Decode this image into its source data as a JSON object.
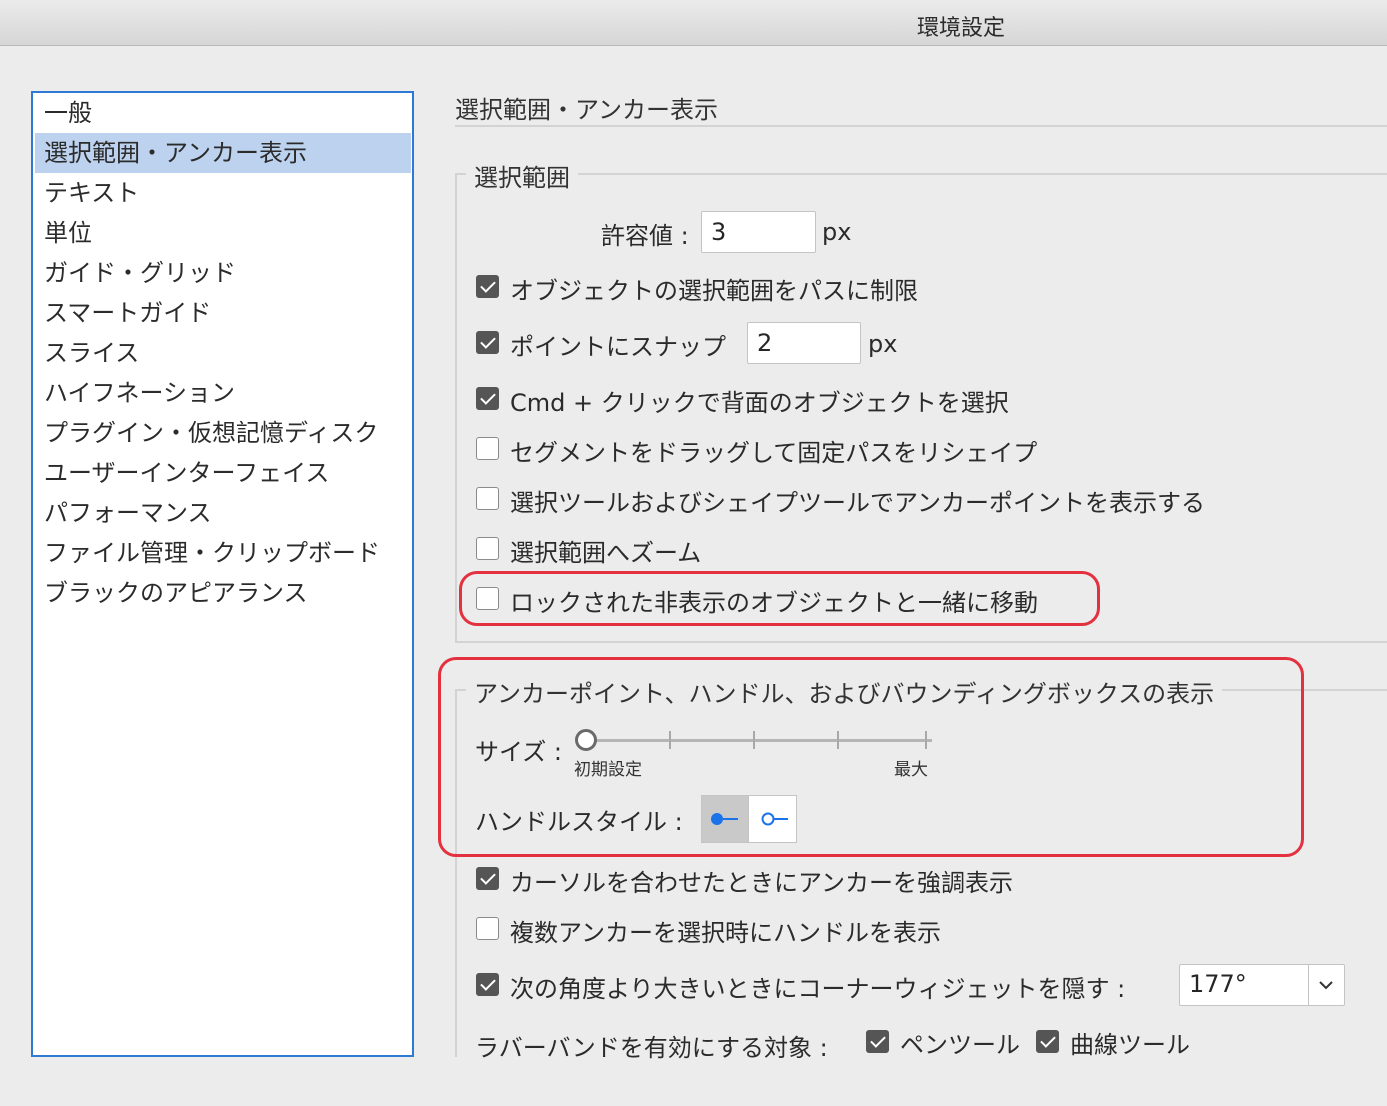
{
  "window": {
    "title": "環境設定"
  },
  "sidebar": {
    "items": [
      {
        "label": "一般"
      },
      {
        "label": "選択範囲・アンカー表示"
      },
      {
        "label": "テキスト"
      },
      {
        "label": "単位"
      },
      {
        "label": "ガイド・グリッド"
      },
      {
        "label": "スマートガイド"
      },
      {
        "label": "スライス"
      },
      {
        "label": "ハイフネーション"
      },
      {
        "label": "プラグイン・仮想記憶ディスク"
      },
      {
        "label": "ユーザーインターフェイス"
      },
      {
        "label": "パフォーマンス"
      },
      {
        "label": "ファイル管理・クリップボード"
      },
      {
        "label": "ブラックのアピアランス"
      }
    ],
    "selected_index": 1
  },
  "main": {
    "title": "選択範囲・アンカー表示",
    "selection_group": {
      "legend": "選択範囲",
      "tolerance": {
        "label": "許容値 :",
        "value": "3",
        "unit": "px"
      },
      "options": {
        "restrict_to_paths": {
          "label": "オブジェクトの選択範囲をパスに制限",
          "checked": true
        },
        "snap_to_point": {
          "label": "ポイントにスナップ",
          "value": "2",
          "unit": "px",
          "checked": true
        },
        "cmd_click": {
          "label": "Cmd + クリックで背面のオブジェクトを選択",
          "checked": true
        },
        "drag_segment": {
          "label": "セグメントをドラッグして固定パスをリシェイプ",
          "checked": false
        },
        "show_anchor_points": {
          "label": "選択ツールおよびシェイプツールでアンカーポイントを表示する",
          "checked": false
        },
        "zoom_to_selection": {
          "label": "選択範囲へズーム",
          "checked": false
        },
        "move_locked_hidden": {
          "label": "ロックされた非表示のオブジェクトと一緒に移動",
          "checked": false
        }
      }
    },
    "anchor_group": {
      "legend": "アンカーポイント、ハンドル、およびバウンディングボックスの表示",
      "size": {
        "label": "サイズ :",
        "min_label": "初期設定",
        "max_label": "最大",
        "value": 0
      },
      "handle_style": {
        "label": "ハンドルスタイル :",
        "selected": "solid"
      }
    },
    "more_options": {
      "highlight_anchor": {
        "label": "カーソルを合わせたときにアンカーを強調表示",
        "checked": true
      },
      "show_handles_multi": {
        "label": "複数アンカーを選択時にハンドルを表示",
        "checked": false
      },
      "hide_corner_widget": {
        "label": "次の角度より大きいときにコーナーウィジェットを隠す :",
        "checked": true,
        "value": "177°"
      },
      "rubber_band": {
        "label": "ラバーバンドを有効にする対象 :",
        "pen_tool": {
          "label": "ペンツール",
          "checked": true
        },
        "curvature_tool": {
          "label": "曲線ツール",
          "checked": true
        }
      }
    }
  },
  "colors": {
    "accent": "#2e79d4",
    "highlight": "#e3313f",
    "selection": "#bdd2ee",
    "handle": "#1a73e8"
  }
}
